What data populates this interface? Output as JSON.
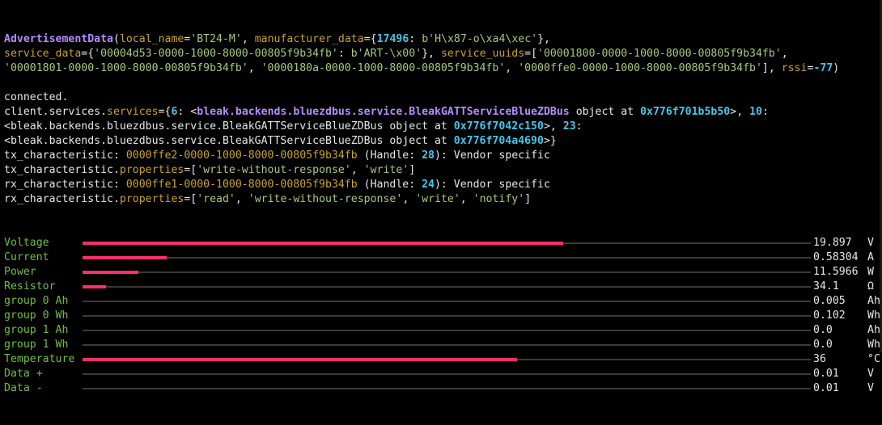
{
  "colors": {
    "bg": "#000000",
    "text": "#e6e6e6",
    "class_name": "#b58cff",
    "kw": "#c9a227",
    "str": "#a8c87a",
    "num": "#46c5e8",
    "label": "#6fbf3f",
    "bar": "#ff2d6f",
    "track": "#3a3a3a"
  },
  "lines": [
    [
      [
        "AdvertisementData",
        "class_name",
        1
      ],
      [
        "(",
        "text"
      ],
      [
        "local_name",
        "kw"
      ],
      [
        "=",
        "text"
      ],
      [
        "'BT24-M'",
        "str"
      ],
      [
        ", ",
        "text"
      ],
      [
        "manufacturer_data",
        "kw"
      ],
      [
        "={",
        "text"
      ],
      [
        "17496",
        "num",
        1
      ],
      [
        ": ",
        "text"
      ],
      [
        "b'H\\x87-o\\xa4\\xec'",
        "str"
      ],
      [
        "},",
        "text"
      ]
    ],
    [
      [
        "service_data",
        "kw"
      ],
      [
        "={",
        "text"
      ],
      [
        "'00004d53-0000-1000-8000-00805f9b34fb'",
        "str"
      ],
      [
        ": ",
        "text"
      ],
      [
        "b'ART-\\x00'",
        "str"
      ],
      [
        "}, ",
        "text"
      ],
      [
        "service_uuids",
        "kw"
      ],
      [
        "=[",
        "text"
      ],
      [
        "'00001800-0000-1000-8000-00805f9b34fb'",
        "str"
      ],
      [
        ",",
        "text"
      ]
    ],
    [
      [
        "'00001801-0000-1000-8000-00805f9b34fb'",
        "str"
      ],
      [
        ", ",
        "text"
      ],
      [
        "'0000180a-0000-1000-8000-00805f9b34fb'",
        "str"
      ],
      [
        ", ",
        "text"
      ],
      [
        "'0000ffe0-0000-1000-8000-00805f9b34fb'",
        "str"
      ],
      [
        "], ",
        "text"
      ],
      [
        "rssi",
        "kw"
      ],
      [
        "=",
        "text"
      ],
      [
        "-77",
        "num",
        1
      ],
      [
        ")",
        "text"
      ]
    ],
    [
      [
        "",
        "text"
      ]
    ],
    [
      [
        "connected.",
        "text"
      ]
    ],
    [
      [
        "client.services.",
        "text"
      ],
      [
        "services",
        "kw"
      ],
      [
        "={",
        "text"
      ],
      [
        "6",
        "num",
        1
      ],
      [
        ": <",
        "text"
      ],
      [
        "bleak.backends.bluezdbus.service.BleakGATTServiceBlueZDBus",
        "class_name",
        1
      ],
      [
        " object at ",
        "text"
      ],
      [
        "0x776f701b5b50",
        "num",
        1
      ],
      [
        ">, ",
        "text"
      ],
      [
        "10",
        "num",
        1
      ],
      [
        ":",
        "text"
      ]
    ],
    [
      [
        "<bleak.backends.bluezdbus.service.BleakGATTServiceBlueZDBus object at ",
        "text"
      ],
      [
        "0x776f7042c150",
        "num",
        1
      ],
      [
        ">, ",
        "text"
      ],
      [
        "23",
        "num",
        1
      ],
      [
        ":",
        "text"
      ]
    ],
    [
      [
        "<bleak.backends.bluezdbus.service.BleakGATTServiceBlueZDBus object at ",
        "text"
      ],
      [
        "0x776f704a4690",
        "num",
        1
      ],
      [
        ">}",
        "text"
      ]
    ],
    [
      [
        "tx_characteristic: ",
        "text"
      ],
      [
        "0000ffe2-0000-1000-8000-00805f9b34fb",
        "kw"
      ],
      [
        " (Handle: ",
        "text"
      ],
      [
        "28",
        "num",
        1
      ],
      [
        "): Vendor specific",
        "text"
      ]
    ],
    [
      [
        "tx_characteristic.",
        "text"
      ],
      [
        "properties",
        "kw"
      ],
      [
        "=[",
        "text"
      ],
      [
        "'write-without-response'",
        "str"
      ],
      [
        ", ",
        "text"
      ],
      [
        "'write'",
        "str"
      ],
      [
        "]",
        "text"
      ]
    ],
    [
      [
        "rx_characteristic: ",
        "text"
      ],
      [
        "0000ffe1-0000-1000-8000-00805f9b34fb",
        "kw"
      ],
      [
        " (Handle: ",
        "text"
      ],
      [
        "24",
        "num",
        1
      ],
      [
        "): Vendor specific",
        "text"
      ]
    ],
    [
      [
        "rx_characteristic.",
        "text"
      ],
      [
        "properties",
        "kw"
      ],
      [
        "=[",
        "text"
      ],
      [
        "'read'",
        "str"
      ],
      [
        ", ",
        "text"
      ],
      [
        "'write-without-response'",
        "str"
      ],
      [
        ", ",
        "text"
      ],
      [
        "'write'",
        "str"
      ],
      [
        ", ",
        "text"
      ],
      [
        "'notify'",
        "str"
      ],
      [
        "]",
        "text"
      ]
    ]
  ],
  "meters": [
    {
      "label": "Voltage",
      "value": "19.897",
      "unit": "V",
      "fill": 0.66
    },
    {
      "label": "Current",
      "value": "0.58304",
      "unit": "A",
      "fill": 0.115
    },
    {
      "label": "Power",
      "value": "11.5966",
      "unit": "W",
      "fill": 0.077
    },
    {
      "label": "Resistor",
      "value": "34.1",
      "unit": "Ω",
      "fill": 0.032
    },
    {
      "label": "group 0 Ah",
      "value": "0.005",
      "unit": "Ah",
      "fill": 0
    },
    {
      "label": "group 0 Wh",
      "value": "0.102",
      "unit": "Wh",
      "fill": 0
    },
    {
      "label": "group 1 Ah",
      "value": "0.0",
      "unit": "Ah",
      "fill": 0
    },
    {
      "label": "group 1 Wh",
      "value": "0.0",
      "unit": "Wh",
      "fill": 0
    },
    {
      "label": "Temperature",
      "value": "36",
      "unit": "°C",
      "fill": 0.597
    },
    {
      "label": "Data +",
      "value": "0.01",
      "unit": "V",
      "fill": 0
    },
    {
      "label": "Data -",
      "value": "0.01",
      "unit": "V",
      "fill": 0
    }
  ]
}
